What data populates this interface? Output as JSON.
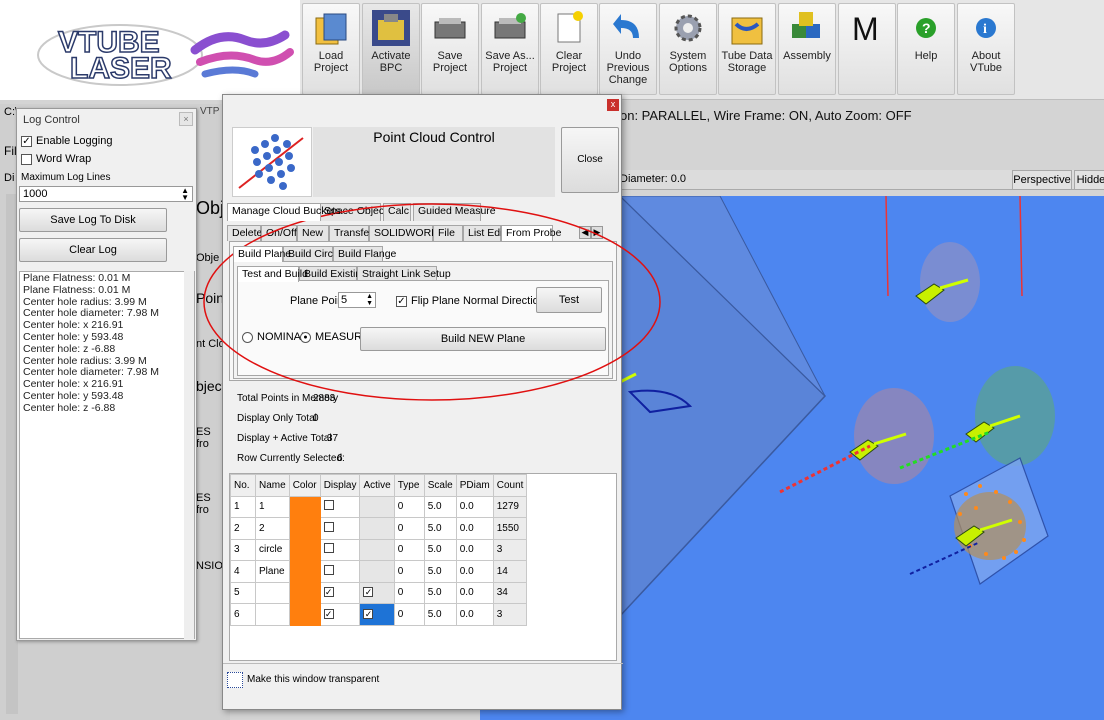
{
  "toolbar": {
    "logo_line1": "VTUBE",
    "logo_line2": "LASER",
    "buttons": [
      {
        "label": "Load Project",
        "icon": "load-project-icon"
      },
      {
        "label": "Activate BPC",
        "icon": "activate-bpc-icon"
      },
      {
        "label": "Save Project",
        "icon": "save-project-icon"
      },
      {
        "label": "Save As... Project",
        "icon": "save-as-icon"
      },
      {
        "label": "Clear Project",
        "icon": "clear-project-icon"
      },
      {
        "label": "Undo Previous Change",
        "icon": "undo-icon"
      },
      {
        "label": "System Options",
        "icon": "gear-icon"
      },
      {
        "label": "Tube Data Storage",
        "icon": "tube-data-icon"
      },
      {
        "label": "Assembly",
        "icon": "assembly-icon"
      },
      {
        "label": "M",
        "icon": "m-icon"
      },
      {
        "label": "Help",
        "icon": "help-icon"
      },
      {
        "label": "About VTube",
        "icon": "about-icon"
      }
    ]
  },
  "status": {
    "text": "on: PARALLEL, Wire Frame: ON, Auto Zoom: OFF",
    "diameter": "Diameter: 0.0",
    "perspective": "Perspective",
    "hidden": "Hidden"
  },
  "background": {
    "path_prefix": "C:\\",
    "path_suffix": "VTP",
    "file_tab": "Fil",
    "d_tab": "Di",
    "fragments": [
      "Object",
      "Obje",
      "Point",
      "nt Clo",
      "bject",
      "ES fro",
      "ES fro",
      "NSIO"
    ]
  },
  "log": {
    "title": "Log Control",
    "enable_logging": "Enable Logging",
    "word_wrap": "Word Wrap",
    "max_lines_label": "Maximum Log Lines",
    "max_lines_value": "1000",
    "save_button": "Save Log To Disk",
    "clear_button": "Clear Log",
    "lines": [
      "Plane Flatness: 0.01 M",
      "Plane Flatness: 0.01 M",
      "Center hole radius: 3.99 M",
      "Center hole diameter: 7.98 M",
      "Center hole: x 216.91",
      "Center hole: y 593.48",
      "Center hole: z -6.88",
      "Center hole radius: 3.99 M",
      "Center hole diameter: 7.98 M",
      "Center hole: x 216.91",
      "Center hole: y 593.48",
      "Center hole: z -6.88"
    ]
  },
  "pcc": {
    "title": "Point Cloud Control",
    "close": "Close",
    "top_tabs": [
      "Manage Cloud Buckets",
      "Space Objects",
      "Calc",
      "Guided Measure"
    ],
    "sub_tabs": [
      "Delete",
      "On/Off",
      "New",
      "Transfer",
      "SOLIDWORKS",
      "File",
      "List Edit",
      "From Probe"
    ],
    "build_tabs": [
      "Build Plane",
      "Build Circle",
      "Build Flange"
    ],
    "test_tabs": [
      "Test and Build",
      "Build  Existing",
      "Straight Link Setup"
    ],
    "plane_points_label": "Plane Points",
    "plane_points_value": "5",
    "flip_label": "Flip Plane Normal Direction",
    "test_button": "Test",
    "nominal": "NOMINAL",
    "measured": "MEASURED",
    "build_button": "Build NEW Plane",
    "stats": [
      {
        "label": "Total Points in Memory",
        "value": "2883"
      },
      {
        "label": "Display Only Total",
        "value": "0"
      },
      {
        "label": "Display + Active Total",
        "value": "37"
      },
      {
        "label": "Row Currently Selected:",
        "value": "6"
      }
    ],
    "table_headers": [
      "No.",
      "Name",
      "Color",
      "Display",
      "Active",
      "Type",
      "Scale",
      "PDiam",
      "Count"
    ],
    "rows": [
      {
        "no": "1",
        "name": "1",
        "display": false,
        "active": false,
        "type": "0",
        "scale": "5.0",
        "pdiam": "0.0",
        "count": "1279"
      },
      {
        "no": "2",
        "name": "2",
        "display": false,
        "active": false,
        "type": "0",
        "scale": "5.0",
        "pdiam": "0.0",
        "count": "1550"
      },
      {
        "no": "3",
        "name": "circle",
        "display": false,
        "active": false,
        "type": "0",
        "scale": "5.0",
        "pdiam": "0.0",
        "count": "3"
      },
      {
        "no": "4",
        "name": "Plane",
        "display": false,
        "active": false,
        "type": "0",
        "scale": "5.0",
        "pdiam": "0.0",
        "count": "14"
      },
      {
        "no": "5",
        "name": "",
        "display": true,
        "active": true,
        "type": "0",
        "scale": "5.0",
        "pdiam": "0.0",
        "count": "34"
      },
      {
        "no": "6",
        "name": "",
        "display": true,
        "active": true,
        "type": "0",
        "scale": "5.0",
        "pdiam": "0.0",
        "count": "3"
      }
    ],
    "transparent_label": "Make this window transparent",
    "colors": {
      "orange": "#ff7f0e",
      "active_blue": "#1e73d6",
      "highlight_red": "#e01010"
    }
  }
}
